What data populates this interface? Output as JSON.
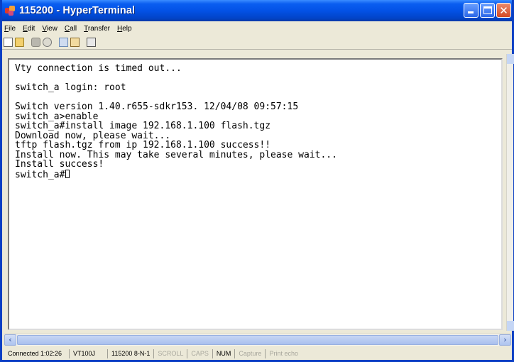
{
  "window": {
    "title": "115200 - HyperTerminal"
  },
  "menu": {
    "items": [
      {
        "underline": "F",
        "rest": "ile"
      },
      {
        "underline": "E",
        "rest": "dit"
      },
      {
        "underline": "V",
        "rest": "iew"
      },
      {
        "underline": "C",
        "rest": "all"
      },
      {
        "underline": "T",
        "rest": "ransfer"
      },
      {
        "underline": "H",
        "rest": "elp"
      }
    ]
  },
  "toolbar": {
    "icons": [
      "new-connection-icon",
      "open-icon",
      "connect-icon",
      "disconnect-icon",
      "send-icon",
      "receive-icon",
      "properties-icon"
    ]
  },
  "terminal": {
    "lines": [
      "Vty connection is timed out...",
      "",
      "switch_a login: root",
      "",
      "Switch version 1.40.r655-sdkr153. 12/04/08 09:57:15",
      "switch_a>enable",
      "switch_a#install image 192.168.1.100 flash.tgz",
      "Download now, please wait...",
      "tftp flash.tgz from ip 192.168.1.100 success!!",
      "Install now. This may take several minutes, please wait...",
      "Install success!",
      "switch_a#"
    ]
  },
  "status": {
    "connected": "Connected 1:02:26",
    "emulation": "VT100J",
    "port_settings": "115200 8-N-1",
    "scroll": "SCROLL",
    "caps": "CAPS",
    "num": "NUM",
    "capture": "Capture",
    "print_echo": "Print echo"
  },
  "colors": {
    "titlebar": "#0352e6",
    "chrome": "#ece9d8",
    "terminal_bg": "#ffffff"
  }
}
